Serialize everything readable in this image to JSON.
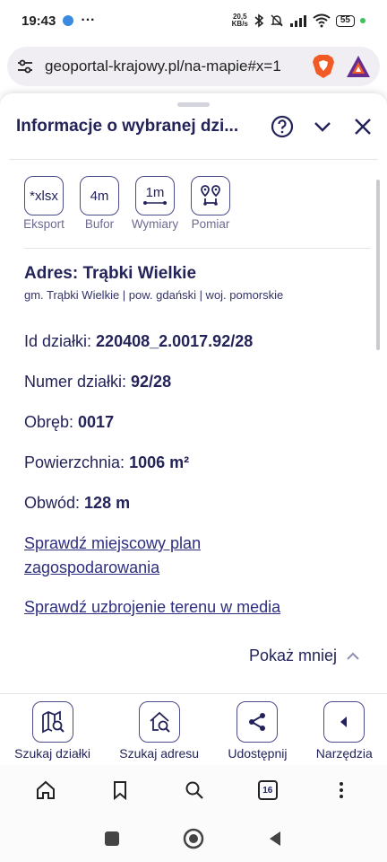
{
  "status_bar": {
    "time": "19:43",
    "net_speed_value": "20,5",
    "net_speed_unit": "KB/s",
    "battery": "55"
  },
  "browser": {
    "url": "geoportal-krajowy.pl/na-mapie#x=1",
    "tab_count": "16"
  },
  "panel": {
    "title": "Informacje o wybranej dzi...",
    "tools": [
      {
        "icon_text": "*xlsx",
        "label": "Eksport"
      },
      {
        "icon_text": "4m",
        "label": "Bufor"
      },
      {
        "icon_text": "1m",
        "label": "Wymiary"
      },
      {
        "icon_text": "",
        "label": "Pomiar"
      }
    ],
    "address_title": "Adres: Trąbki Wielkie",
    "address_sub": "gm. Trąbki Wielkie | pow. gdański | woj. pomorskie",
    "fields": [
      {
        "label": "Id działki: ",
        "value": "220408_2.0017.92/28"
      },
      {
        "label": "Numer działki: ",
        "value": "92/28"
      },
      {
        "label": "Obręb: ",
        "value": "0017"
      },
      {
        "label": "Powierzchnia: ",
        "value": "1006 m²"
      },
      {
        "label": "Obwód: ",
        "value": "128 m"
      }
    ],
    "link_plan_line1": "Sprawdź miejscowy plan",
    "link_plan_line2": "zagospodarowania",
    "link_media": "Sprawdź uzbrojenie terenu w media",
    "show_less": "Pokaż mniej"
  },
  "bottom_nav": [
    {
      "label": "Szukaj działki"
    },
    {
      "label": "Szukaj adresu"
    },
    {
      "label": "Udostępnij"
    },
    {
      "label": "Narzędzia"
    }
  ],
  "colors": {
    "primary_text": "#23235a",
    "accent_border": "#4b4b8a",
    "link": "#2e2e80",
    "brave_orange": "#f15a24",
    "bat_purple": "#662d91"
  }
}
